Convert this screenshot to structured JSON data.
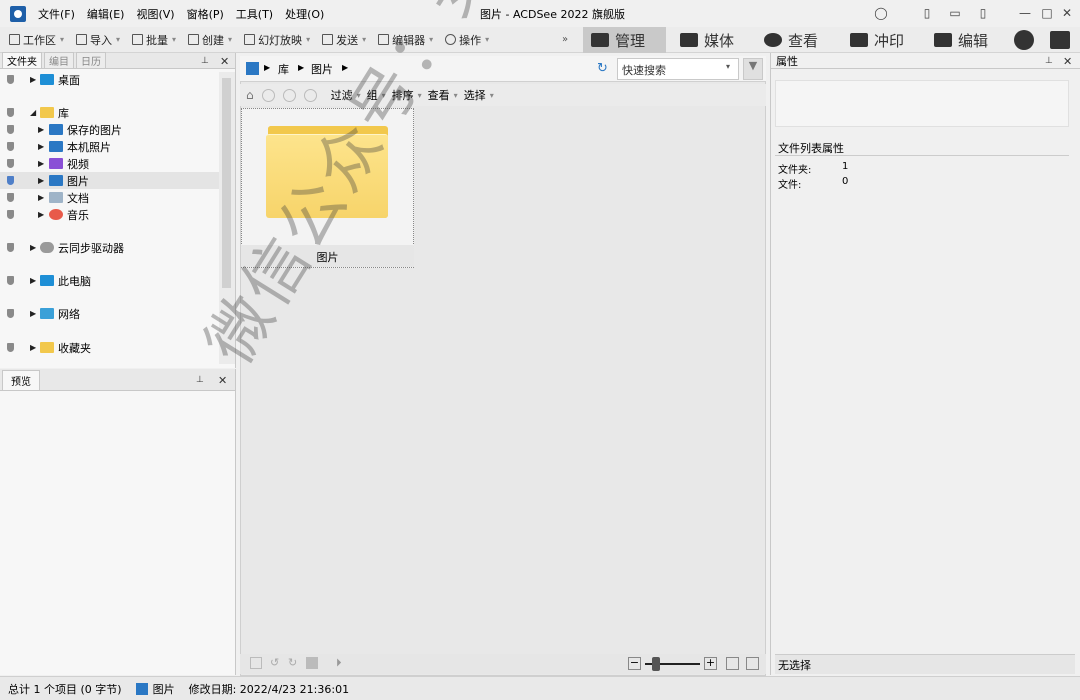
{
  "window": {
    "title": "图片 - ACDSee 2022 旗舰版"
  },
  "menu": [
    "文件(F)",
    "编辑(E)",
    "视图(V)",
    "窗格(P)",
    "工具(T)",
    "处理(O)"
  ],
  "toolbar": {
    "items": [
      "工作区",
      "导入",
      "批量",
      "创建",
      "幻灯放映",
      "发送",
      "编辑器",
      "操作"
    ],
    "modes": [
      "管理",
      "媒体",
      "查看",
      "冲印",
      "编辑"
    ]
  },
  "left_panel": {
    "tabs": [
      "文件夹",
      "编目",
      "日历"
    ],
    "tree": [
      {
        "label": "桌面"
      },
      {
        "label": "库"
      },
      {
        "label": "保存的图片"
      },
      {
        "label": "本机照片"
      },
      {
        "label": "视频"
      },
      {
        "label": "图片"
      },
      {
        "label": "文档"
      },
      {
        "label": "音乐"
      },
      {
        "label": "云同步驱动器"
      },
      {
        "label": "此电脑"
      },
      {
        "label": "网络"
      },
      {
        "label": "收藏夹"
      }
    ],
    "preview_title": "预览"
  },
  "center": {
    "breadcrumb": [
      "库",
      "图片"
    ],
    "search_placeholder": "快速搜索",
    "filters": [
      "过滤",
      "组",
      "排序",
      "查看",
      "选择"
    ],
    "items": [
      {
        "name": "图片"
      }
    ]
  },
  "right_panel": {
    "title": "属性",
    "section": "文件列表属性",
    "props": [
      {
        "label": "文件夹:",
        "value": "1"
      },
      {
        "label": "文件:",
        "value": "0"
      }
    ],
    "no_selection": "无选择"
  },
  "status": {
    "summary": "总计 1 个项目 (0 字节)",
    "location": "图片",
    "modified": "修改日期: 2022/4/23 21:36:01"
  },
  "watermark": "微信公众号：安装软件指南"
}
